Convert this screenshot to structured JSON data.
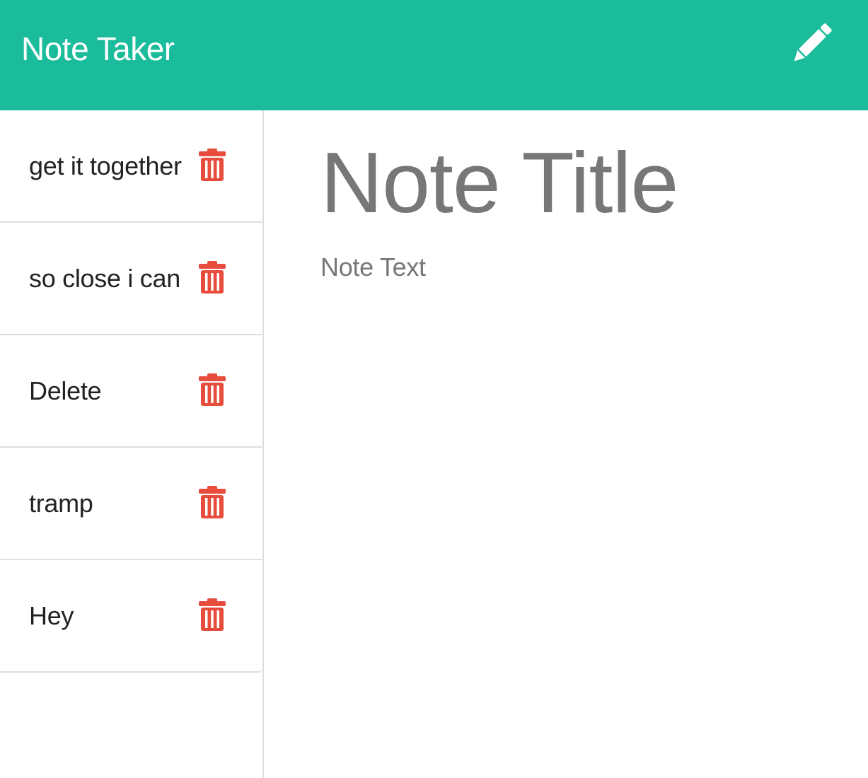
{
  "app": {
    "brand": "Note Taker"
  },
  "colors": {
    "navbar": "#1abc9c",
    "delete_icon": "#e74c3c",
    "placeholder_text": "#777777"
  },
  "icons": {
    "new_note": "pencil-icon",
    "delete": "trash-icon"
  },
  "sidebar": {
    "notes": [
      {
        "title": "get it together"
      },
      {
        "title": "so close i can"
      },
      {
        "title": "Delete"
      },
      {
        "title": "tramp"
      },
      {
        "title": "Hey"
      }
    ]
  },
  "editor": {
    "title_placeholder": "Note Title",
    "text_placeholder": "Note Text"
  }
}
